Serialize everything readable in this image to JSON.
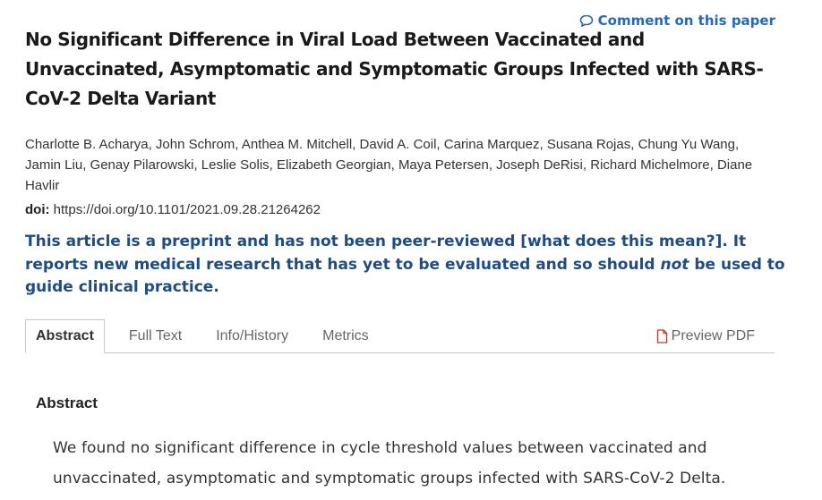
{
  "comment": {
    "label": "Comment on this paper",
    "icon": "speech-bubble-icon"
  },
  "article": {
    "title": "No Significant Difference in Viral Load Between Vaccinated and Unvaccinated, Asymptomatic and Symptomatic Groups Infected with SARS-CoV-2 Delta Variant",
    "authors": [
      "Charlotte B. Acharya",
      "John Schrom",
      "Anthea M. Mitchell",
      "David A. Coil",
      "Carina Marquez",
      "Susana Rojas",
      "Chung Yu Wang",
      "Jamin Liu",
      "Genay Pilarowski",
      "Leslie Solis",
      "Elizabeth Georgian",
      "Maya Petersen",
      "Joseph DeRisi",
      "Richard Michelmore",
      "Diane Havlir"
    ],
    "doi_label": "doi:",
    "doi_url": "https://doi.org/10.1101/2021.09.28.21264262"
  },
  "notice": {
    "part1": "This article is a preprint and has not been peer-reviewed ",
    "link": "[what does this mean?]",
    "part2": ". It reports new medical research that has yet to be evaluated and so should ",
    "emphasis": "not",
    "part3": " be used to guide clinical practice."
  },
  "tabs": {
    "items": [
      "Abstract",
      "Full Text",
      "Info/History",
      "Metrics"
    ],
    "active": "Abstract",
    "pdf_label": "Preview PDF",
    "pdf_icon": "document-icon"
  },
  "abstract": {
    "heading": "Abstract",
    "text": "We found no significant difference in cycle threshold values between vaccinated and unvaccinated, asymptomatic and symptomatic groups infected with SARS-CoV-2 Delta."
  },
  "colors": {
    "link_blue": "#2669b8",
    "notice_blue": "#1f4c82",
    "pdf_icon_red": "#c0392b"
  }
}
